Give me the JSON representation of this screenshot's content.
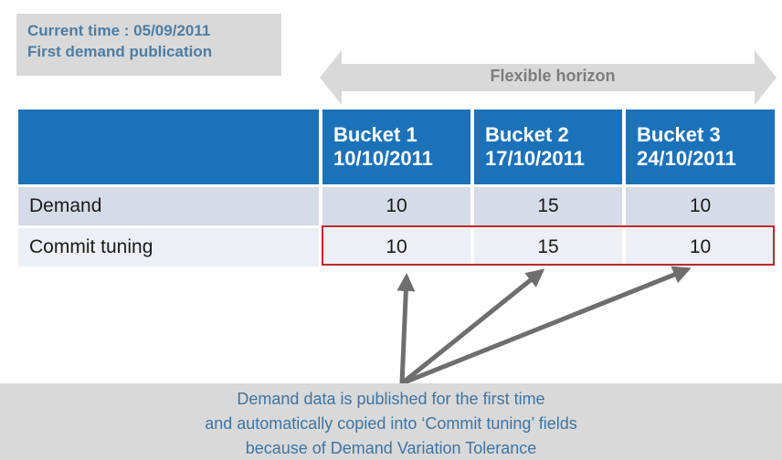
{
  "info": {
    "line1": "Current time : 05/09/2011",
    "line2": "First demand publication"
  },
  "horizon": {
    "label": "Flexible horizon"
  },
  "table": {
    "buckets": [
      {
        "name": "Bucket 1",
        "date": "10/10/2011"
      },
      {
        "name": "Bucket 2",
        "date": "17/10/2011"
      },
      {
        "name": "Bucket 3",
        "date": "24/10/2011"
      }
    ],
    "rows": [
      {
        "label": "Demand",
        "values": [
          "10",
          "15",
          "10"
        ]
      },
      {
        "label": "Commit tuning",
        "values": [
          "10",
          "15",
          "10"
        ]
      }
    ]
  },
  "note": {
    "line1": "Demand data is published for the first time",
    "line2": "and automatically copied into ‘Commit tuning’ fields",
    "line3": "because of Demand Variation Tolerance"
  },
  "colors": {
    "header_blue": "#1c72b9",
    "demand_row": "#d5dbe8",
    "commit_row": "#eceff5",
    "highlight_red": "#c0272d",
    "info_text": "#4d7da3",
    "note_text": "#3e74a3",
    "arrow_gray": "#6e6e6e"
  }
}
